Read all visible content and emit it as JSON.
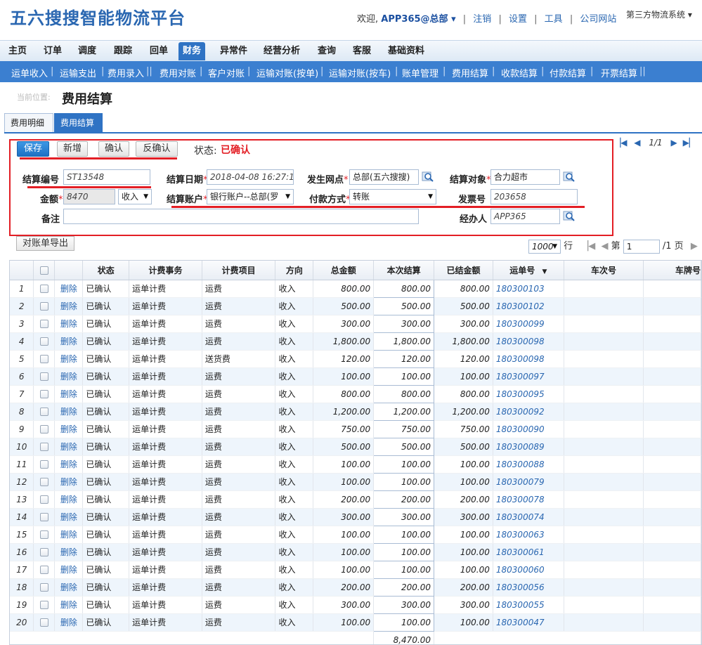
{
  "header": {
    "logo": "五六搜搜智能物流平台",
    "welcome": "欢迎,",
    "user": "APP365@总部",
    "links": [
      "注销",
      "设置",
      "工具",
      "公司网站"
    ],
    "system_select": "第三方物流系统"
  },
  "main_nav": [
    "主页",
    "订单",
    "调度",
    "跟踪",
    "回单",
    "财务",
    "异常件",
    "经营分析",
    "查询",
    "客服",
    "基础资料"
  ],
  "main_nav_active": "财务",
  "sub_nav": [
    "运单收入",
    "运输支出",
    "费用录入",
    "费用对账",
    "客户对账",
    "运输对账(按单)",
    "运输对账(按车)",
    "账单管理",
    "费用结算",
    "收款结算",
    "付款结算",
    "开票结算"
  ],
  "breadcrumb": "当前位置:",
  "page_title": "费用结算",
  "tabs": [
    "费用明细",
    "费用结算"
  ],
  "toolbar": {
    "save": "保存",
    "add": "新增",
    "confirm": "确认",
    "unconfirm": "反确认",
    "status_label": "状态:",
    "status_value": "已确认"
  },
  "form": {
    "settle_no_label": "结算编号",
    "settle_no": "ST13548",
    "settle_date_label": "结算日期",
    "settle_date": "2018-04-08 16:27:14",
    "branch_label": "发生网点",
    "branch": "总部(五六搜搜)",
    "object_label": "结算对象",
    "object": "合力超市",
    "amount_label": "金额",
    "amount": "8470",
    "direction": "收入",
    "account_label": "结算账户",
    "account": "银行账户--总部(罗",
    "pay_label": "付款方式",
    "pay": "转账",
    "invoice_label": "发票号",
    "invoice": "203658",
    "remark_label": "备注",
    "remark": "",
    "handler_label": "经办人",
    "handler": "APP365"
  },
  "top_pager": "1/1",
  "export_button": "对账单导出",
  "grid_pager": {
    "page_size": "1000",
    "rows_label": "行",
    "page_prefix": "第",
    "page": "1",
    "page_suffix": "/1 页"
  },
  "table": {
    "columns": [
      "状态",
      "计费事务",
      "计费项目",
      "方向",
      "总金额",
      "本次结算",
      "已结金额",
      "运单号",
      "车次号",
      "车牌号"
    ],
    "delete_label": "删除",
    "rows": [
      {
        "no": "1",
        "status": "已确认",
        "event": "运单计费",
        "item": "运费",
        "dir": "收入",
        "total": "800.00",
        "current": "800.00",
        "settled": "800.00",
        "waybill": "180300103"
      },
      {
        "no": "2",
        "status": "已确认",
        "event": "运单计费",
        "item": "运费",
        "dir": "收入",
        "total": "500.00",
        "current": "500.00",
        "settled": "500.00",
        "waybill": "180300102"
      },
      {
        "no": "3",
        "status": "已确认",
        "event": "运单计费",
        "item": "运费",
        "dir": "收入",
        "total": "300.00",
        "current": "300.00",
        "settled": "300.00",
        "waybill": "180300099"
      },
      {
        "no": "4",
        "status": "已确认",
        "event": "运单计费",
        "item": "运费",
        "dir": "收入",
        "total": "1,800.00",
        "current": "1,800.00",
        "settled": "1,800.00",
        "waybill": "180300098"
      },
      {
        "no": "5",
        "status": "已确认",
        "event": "运单计费",
        "item": "送货费",
        "dir": "收入",
        "total": "120.00",
        "current": "120.00",
        "settled": "120.00",
        "waybill": "180300098"
      },
      {
        "no": "6",
        "status": "已确认",
        "event": "运单计费",
        "item": "运费",
        "dir": "收入",
        "total": "100.00",
        "current": "100.00",
        "settled": "100.00",
        "waybill": "180300097"
      },
      {
        "no": "7",
        "status": "已确认",
        "event": "运单计费",
        "item": "运费",
        "dir": "收入",
        "total": "800.00",
        "current": "800.00",
        "settled": "800.00",
        "waybill": "180300095"
      },
      {
        "no": "8",
        "status": "已确认",
        "event": "运单计费",
        "item": "运费",
        "dir": "收入",
        "total": "1,200.00",
        "current": "1,200.00",
        "settled": "1,200.00",
        "waybill": "180300092"
      },
      {
        "no": "9",
        "status": "已确认",
        "event": "运单计费",
        "item": "运费",
        "dir": "收入",
        "total": "750.00",
        "current": "750.00",
        "settled": "750.00",
        "waybill": "180300090"
      },
      {
        "no": "10",
        "status": "已确认",
        "event": "运单计费",
        "item": "运费",
        "dir": "收入",
        "total": "500.00",
        "current": "500.00",
        "settled": "500.00",
        "waybill": "180300089"
      },
      {
        "no": "11",
        "status": "已确认",
        "event": "运单计费",
        "item": "运费",
        "dir": "收入",
        "total": "100.00",
        "current": "100.00",
        "settled": "100.00",
        "waybill": "180300088"
      },
      {
        "no": "12",
        "status": "已确认",
        "event": "运单计费",
        "item": "运费",
        "dir": "收入",
        "total": "100.00",
        "current": "100.00",
        "settled": "100.00",
        "waybill": "180300079"
      },
      {
        "no": "13",
        "status": "已确认",
        "event": "运单计费",
        "item": "运费",
        "dir": "收入",
        "total": "200.00",
        "current": "200.00",
        "settled": "200.00",
        "waybill": "180300078"
      },
      {
        "no": "14",
        "status": "已确认",
        "event": "运单计费",
        "item": "运费",
        "dir": "收入",
        "total": "300.00",
        "current": "300.00",
        "settled": "300.00",
        "waybill": "180300074"
      },
      {
        "no": "15",
        "status": "已确认",
        "event": "运单计费",
        "item": "运费",
        "dir": "收入",
        "total": "100.00",
        "current": "100.00",
        "settled": "100.00",
        "waybill": "180300063"
      },
      {
        "no": "16",
        "status": "已确认",
        "event": "运单计费",
        "item": "运费",
        "dir": "收入",
        "total": "100.00",
        "current": "100.00",
        "settled": "100.00",
        "waybill": "180300061"
      },
      {
        "no": "17",
        "status": "已确认",
        "event": "运单计费",
        "item": "运费",
        "dir": "收入",
        "total": "100.00",
        "current": "100.00",
        "settled": "100.00",
        "waybill": "180300060"
      },
      {
        "no": "18",
        "status": "已确认",
        "event": "运单计费",
        "item": "运费",
        "dir": "收入",
        "total": "200.00",
        "current": "200.00",
        "settled": "200.00",
        "waybill": "180300056"
      },
      {
        "no": "19",
        "status": "已确认",
        "event": "运单计费",
        "item": "运费",
        "dir": "收入",
        "total": "300.00",
        "current": "300.00",
        "settled": "300.00",
        "waybill": "180300055"
      },
      {
        "no": "20",
        "status": "已确认",
        "event": "运单计费",
        "item": "运费",
        "dir": "收入",
        "total": "100.00",
        "current": "100.00",
        "settled": "100.00",
        "waybill": "180300047"
      }
    ],
    "sum_current": "8,470.00"
  },
  "colors": {
    "brand": "#2a67b1",
    "nav_active": "#2f73c4",
    "subnav": "#3b7fd0",
    "alert": "#e31e25"
  }
}
